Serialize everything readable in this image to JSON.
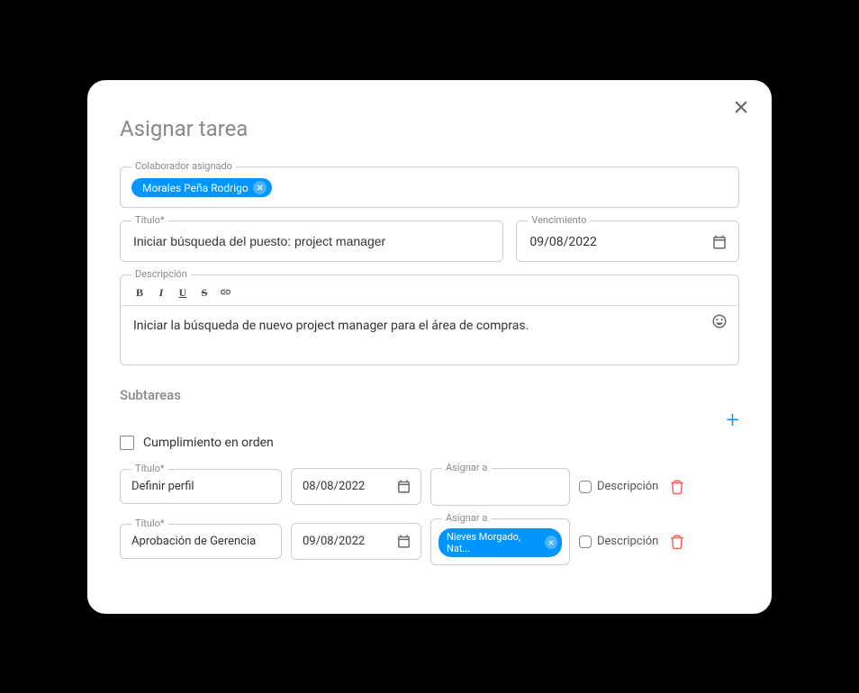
{
  "modal": {
    "title": "Asignar tarea",
    "collaborator_label": "Colaborador asignado",
    "collaborator_chip": "Morales Peña Rodrigo",
    "title_label": "Título*",
    "title_value": "Iniciar búsqueda del puesto: project manager",
    "due_label": "Vencimiento",
    "due_value": "09/08/2022",
    "description_label": "Descripción",
    "description_value": "Iniciar la búsqueda de nuevo project manager para el área de compras."
  },
  "subtasks": {
    "section_label": "Subtareas",
    "order_label": "Cumplimiento en orden",
    "title_label": "Título*",
    "assign_label": "Asignar a",
    "desc_toggle_label": "Descripción",
    "items": [
      {
        "title": "Definir perfil",
        "date": "08/08/2022",
        "assignee": ""
      },
      {
        "title": "Aprobación de Gerencia",
        "date": "09/08/2022",
        "assignee": "Nieves Morgado, Nat..."
      }
    ]
  }
}
